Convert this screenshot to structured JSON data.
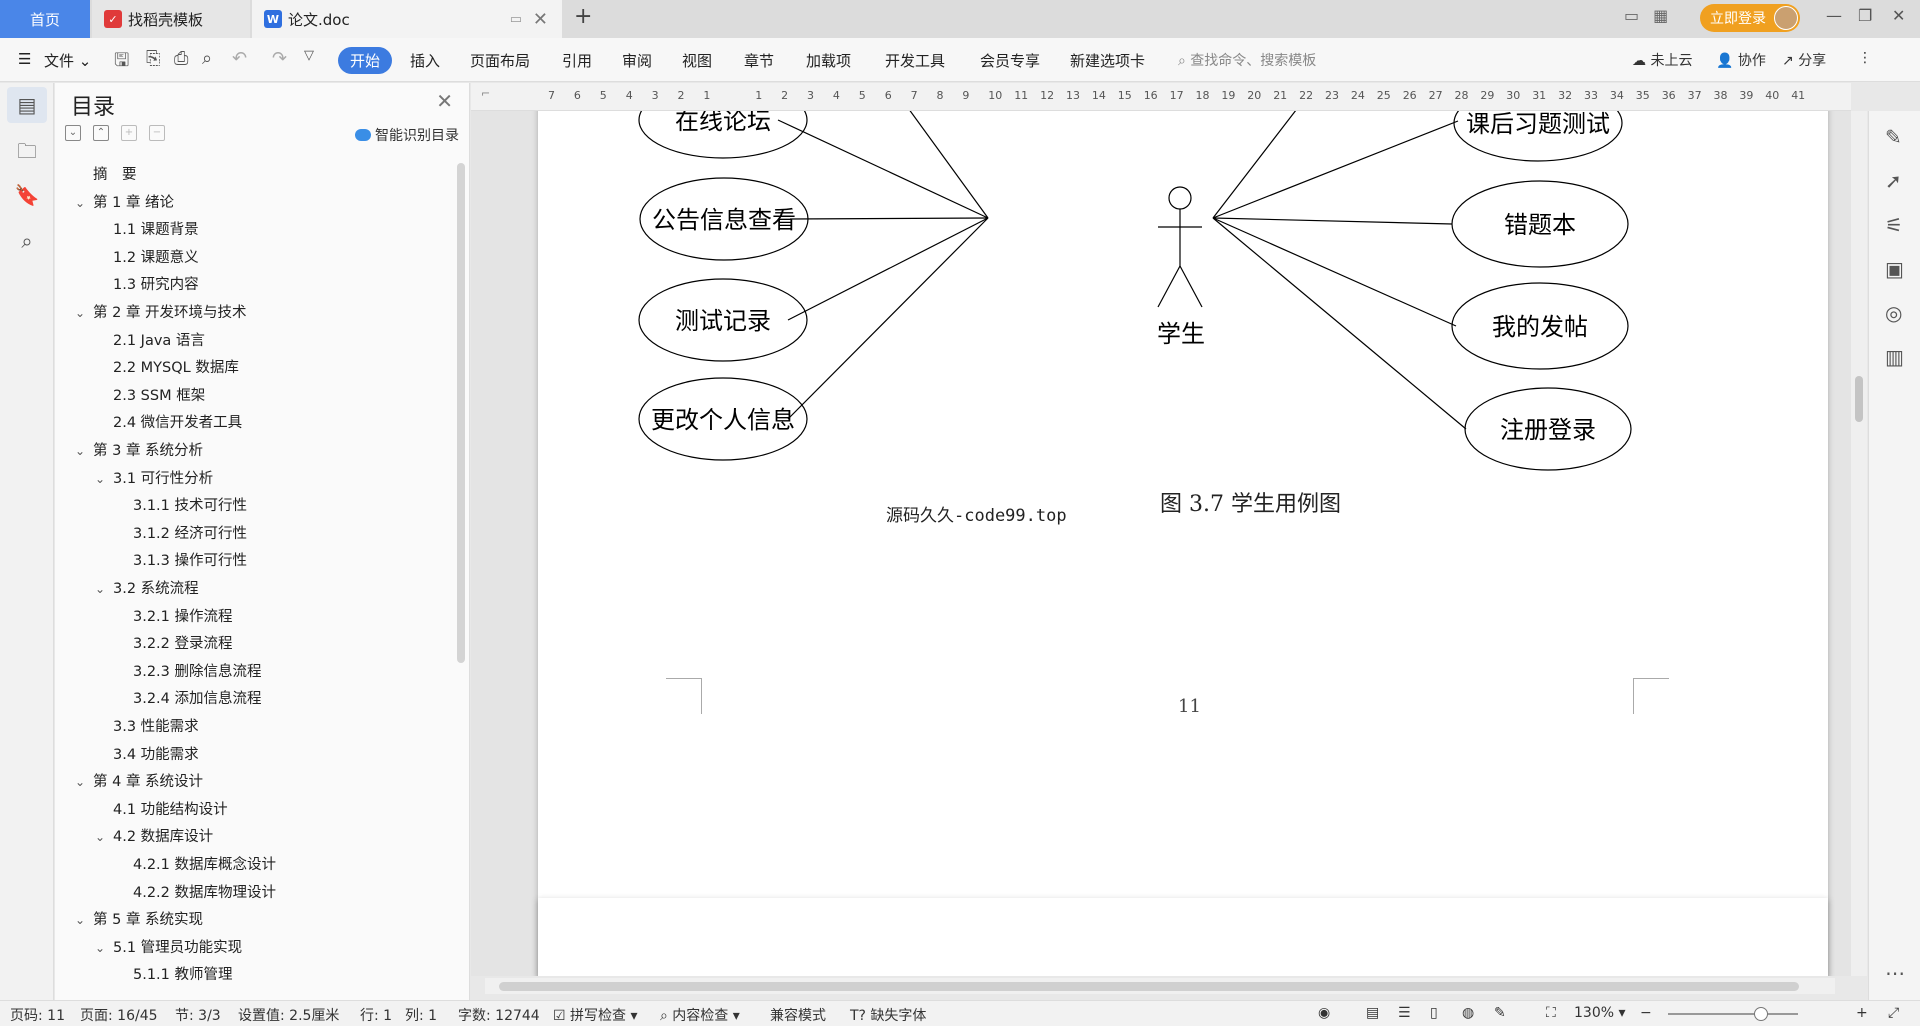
{
  "tabs": [
    {
      "label": "首页"
    },
    {
      "label": "找稻壳模板"
    },
    {
      "label": "论文.doc"
    }
  ],
  "login_label": "立即登录",
  "menu": {
    "file": "文件",
    "items": [
      "开始",
      "插入",
      "页面布局",
      "引用",
      "审阅",
      "视图",
      "章节",
      "加载项",
      "开发工具",
      "会员专享",
      "新建选项卡"
    ],
    "search_placeholder": "查找命令、搜索模板",
    "cloud": "未上云",
    "collab": "协作",
    "share": "分享"
  },
  "toc": {
    "title": "目录",
    "smart_label": "智能识别目录",
    "items": [
      {
        "text": "摘　要",
        "level": 0,
        "chev": false
      },
      {
        "text": "第 1 章  绪论",
        "level": 0,
        "chev": true
      },
      {
        "text": "1.1  课题背景",
        "level": 1,
        "chev": false
      },
      {
        "text": "1.2  课题意义",
        "level": 1,
        "chev": false
      },
      {
        "text": "1.3  研究内容",
        "level": 1,
        "chev": false
      },
      {
        "text": "第 2 章  开发环境与技术",
        "level": 0,
        "chev": true
      },
      {
        "text": "2.1 Java 语言",
        "level": 1,
        "chev": false
      },
      {
        "text": "2.2 MYSQL 数据库",
        "level": 1,
        "chev": false
      },
      {
        "text": "2.3 SSM 框架",
        "level": 1,
        "chev": false
      },
      {
        "text": "2.4 微信开发者工具",
        "level": 1,
        "chev": false
      },
      {
        "text": "第 3 章  系统分析",
        "level": 0,
        "chev": true
      },
      {
        "text": "3.1  可行性分析",
        "level": 1,
        "chev": true
      },
      {
        "text": "3.1.1  技术可行性",
        "level": 2,
        "chev": false
      },
      {
        "text": "3.1.2  经济可行性",
        "level": 2,
        "chev": false
      },
      {
        "text": "3.1.3  操作可行性",
        "level": 2,
        "chev": false
      },
      {
        "text": "3.2  系统流程",
        "level": 1,
        "chev": true
      },
      {
        "text": "3.2.1  操作流程",
        "level": 2,
        "chev": false
      },
      {
        "text": "3.2.2  登录流程",
        "level": 2,
        "chev": false
      },
      {
        "text": "3.2.3  删除信息流程",
        "level": 2,
        "chev": false
      },
      {
        "text": "3.2.4  添加信息流程",
        "level": 2,
        "chev": false
      },
      {
        "text": "3.3  性能需求",
        "level": 1,
        "chev": false
      },
      {
        "text": "3.4  功能需求",
        "level": 1,
        "chev": false
      },
      {
        "text": "第 4 章  系统设计",
        "level": 0,
        "chev": true
      },
      {
        "text": "4.1  功能结构设计",
        "level": 1,
        "chev": false
      },
      {
        "text": "4.2  数据库设计",
        "level": 1,
        "chev": true
      },
      {
        "text": "4.2.1  数据库概念设计",
        "level": 2,
        "chev": false
      },
      {
        "text": "4.2.2  数据库物理设计",
        "level": 2,
        "chev": false
      },
      {
        "text": "第 5 章  系统实现",
        "level": 0,
        "chev": true
      },
      {
        "text": "5.1  管理员功能实现",
        "level": 1,
        "chev": true
      },
      {
        "text": "5.1.1  教师管理",
        "level": 2,
        "chev": false
      }
    ]
  },
  "ruler_ticks": [
    "7",
    "6",
    "5",
    "4",
    "3",
    "2",
    "1",
    "",
    "1",
    "2",
    "3",
    "4",
    "5",
    "6",
    "7",
    "8",
    "9",
    "10",
    "11",
    "12",
    "13",
    "14",
    "15",
    "16",
    "17",
    "18",
    "19",
    "20",
    "21",
    "22",
    "23",
    "24",
    "25",
    "26",
    "27",
    "28",
    "29",
    "30",
    "31",
    "32",
    "33",
    "34",
    "35",
    "36",
    "37",
    "38",
    "39",
    "40",
    "41"
  ],
  "diagram": {
    "actor": "学生",
    "left_cases": [
      "在线论坛",
      "公告信息查看",
      "测试记录",
      "更改个人信息"
    ],
    "right_cases": [
      "课后习题测试",
      "错题本",
      "我的发帖",
      "注册登录"
    ]
  },
  "caption": "图 3.7  学生用例图",
  "watermark": "源码久久-code99.top",
  "page_number": "11",
  "status": {
    "page_code": "页码: 11",
    "page": "页面: 16/45",
    "section": "节: 3/3",
    "setting": "设置值: 2.5厘米",
    "row": "行: 1",
    "col": "列: 1",
    "words": "字数: 12744",
    "spell": "拼写检查",
    "content_check": "内容检查",
    "compat": "兼容模式",
    "missing_font": "缺失字体",
    "zoom": "130%"
  }
}
